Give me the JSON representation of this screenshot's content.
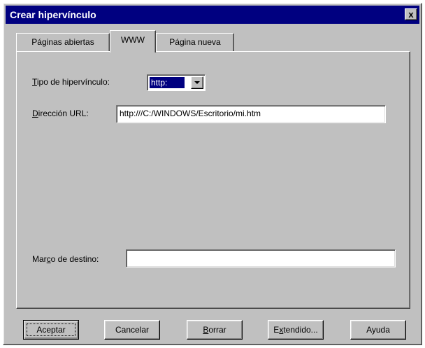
{
  "window": {
    "title": "Crear hipervínculo",
    "close_label": "x"
  },
  "tabs": [
    {
      "label": "Páginas abiertas",
      "active": false
    },
    {
      "label": "WWW",
      "active": true
    },
    {
      "label": "Página nueva",
      "active": false
    }
  ],
  "form": {
    "tipo_label_u": "T",
    "tipo_label_rest": "ipo de hipervínculo:",
    "tipo_value": "http:",
    "url_label_u": "D",
    "url_label_rest": "irección URL:",
    "url_value": "http:///C:/WINDOWS/Escritorio/mi.htm",
    "marco_label_pre": "Mar",
    "marco_label_u": "c",
    "marco_label_post": "o de destino:",
    "marco_value": ""
  },
  "buttons": {
    "aceptar": "Aceptar",
    "cancelar": "Cancelar",
    "borrar_u": "B",
    "borrar_rest": "orrar",
    "extendido_pre": "E",
    "extendido_u": "x",
    "extendido_post": "tendido...",
    "ayuda": "Ayuda"
  }
}
